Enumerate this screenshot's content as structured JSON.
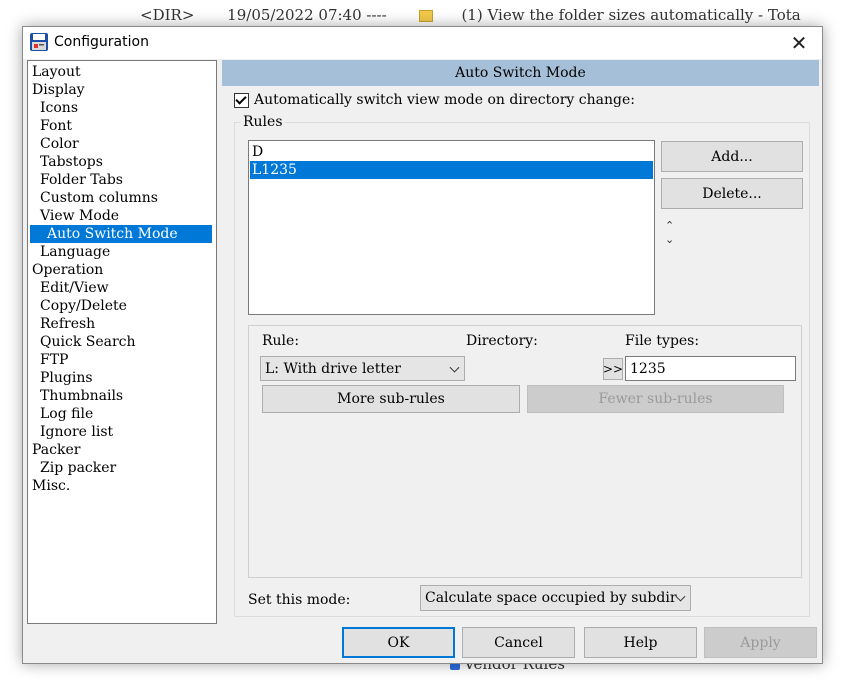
{
  "background": {
    "top_items": [
      "<DIR>",
      "19/05/2022 07:40 ----",
      "(1) View the folder sizes automatically - Tota"
    ],
    "bottom_text": "Vendor Rules"
  },
  "dialog": {
    "title": "Configuration",
    "close_label": "✕"
  },
  "tree": {
    "items": [
      {
        "label": "Layout",
        "level": 1
      },
      {
        "label": "Display",
        "level": 1
      },
      {
        "label": "Icons",
        "level": 2
      },
      {
        "label": "Font",
        "level": 2
      },
      {
        "label": "Color",
        "level": 2
      },
      {
        "label": "Tabstops",
        "level": 2
      },
      {
        "label": "Folder Tabs",
        "level": 2
      },
      {
        "label": "Custom columns",
        "level": 2
      },
      {
        "label": "View Mode",
        "level": 2
      },
      {
        "label": "Auto Switch Mode",
        "level": 3,
        "selected": true
      },
      {
        "label": "Language",
        "level": 2
      },
      {
        "label": "Operation",
        "level": 1
      },
      {
        "label": "Edit/View",
        "level": 2
      },
      {
        "label": "Copy/Delete",
        "level": 2
      },
      {
        "label": "Refresh",
        "level": 2
      },
      {
        "label": "Quick Search",
        "level": 2
      },
      {
        "label": "FTP",
        "level": 2
      },
      {
        "label": "Plugins",
        "level": 2
      },
      {
        "label": "Thumbnails",
        "level": 2
      },
      {
        "label": "Log file",
        "level": 2
      },
      {
        "label": "Ignore list",
        "level": 2
      },
      {
        "label": "Packer",
        "level": 1
      },
      {
        "label": "Zip packer",
        "level": 2
      },
      {
        "label": "Misc.",
        "level": 1
      }
    ]
  },
  "panel": {
    "header": "Auto Switch Mode",
    "auto_switch_label": "Automatically switch view mode on directory change:",
    "auto_switch_checked": true,
    "rules_group_label": "Rules",
    "rules": [
      {
        "label": "D",
        "selected": false
      },
      {
        "label": "L1235",
        "selected": true
      }
    ],
    "add_button": "Add...",
    "delete_button": "Delete...",
    "move_up_icon": "chevron-up-icon",
    "move_down_icon": "chevron-down-icon",
    "rule_label": "Rule:",
    "directory_label": "Directory:",
    "file_types_label": "File types:",
    "rule_select_value": "L: With drive letter",
    "browse_button": ">>",
    "file_types_value": "1235",
    "more_subrules_button": "More sub-rules",
    "fewer_subrules_button": "Fewer sub-rules",
    "set_mode_label": "Set this mode:",
    "set_mode_value": "Calculate space occupied by subdir"
  },
  "footer": {
    "ok": "OK",
    "cancel": "Cancel",
    "help": "Help",
    "apply": "Apply"
  },
  "colors": {
    "selection": "#0078d7",
    "header_bar": "#a6bfd9",
    "dialog_bg": "#f0f0f0"
  }
}
